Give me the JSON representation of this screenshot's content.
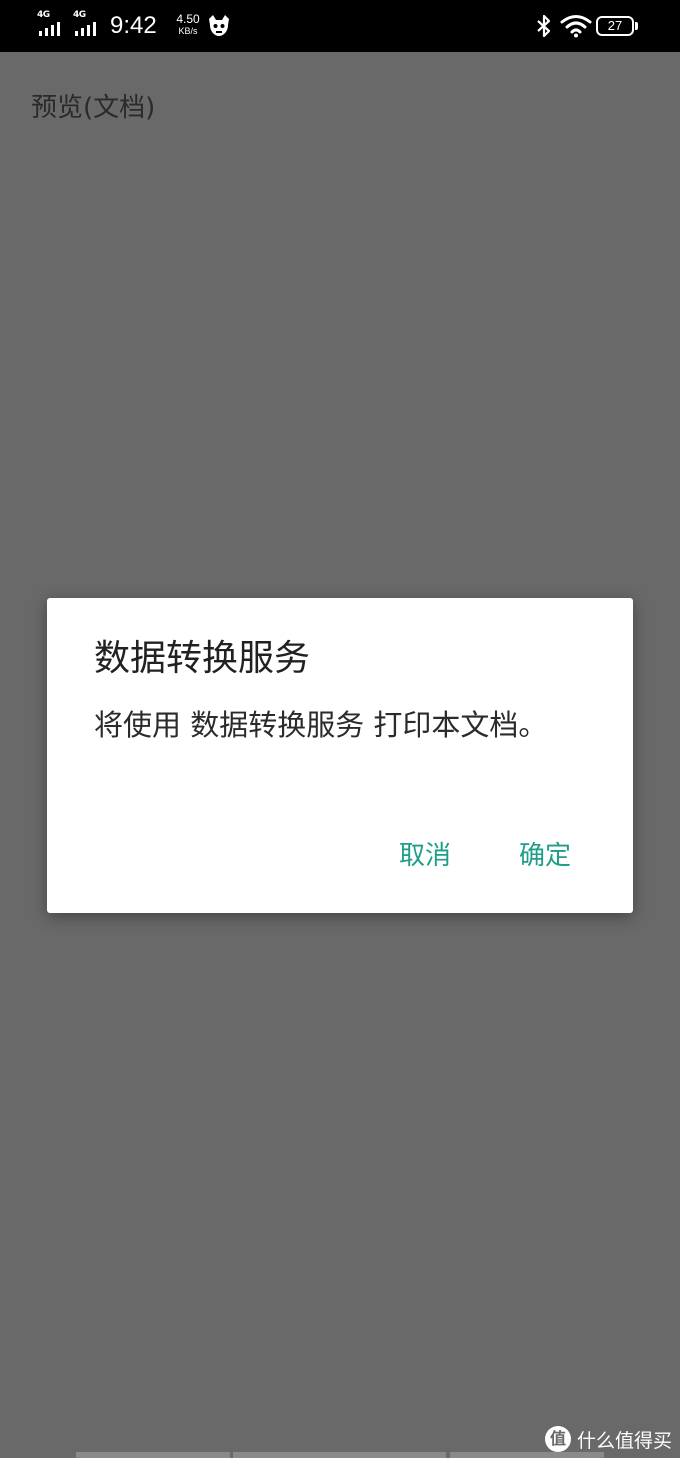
{
  "status_bar": {
    "sim1_network": "4G",
    "sim2_network": "4G",
    "time": "9:42",
    "net_speed_value": "4.50",
    "net_speed_unit": "KB/s",
    "battery_level": "27"
  },
  "app": {
    "title": "预览(文档)"
  },
  "dialog": {
    "title": "数据转换服务",
    "message": "将使用 数据转换服务 打印本文档。",
    "cancel_label": "取消",
    "ok_label": "确定"
  },
  "watermark": {
    "badge": "值",
    "text": "什么值得买"
  },
  "colors": {
    "status_bar_bg": "#000000",
    "scrim": "#696969",
    "dialog_bg": "#ffffff",
    "button_accent": "#1f9e89"
  }
}
